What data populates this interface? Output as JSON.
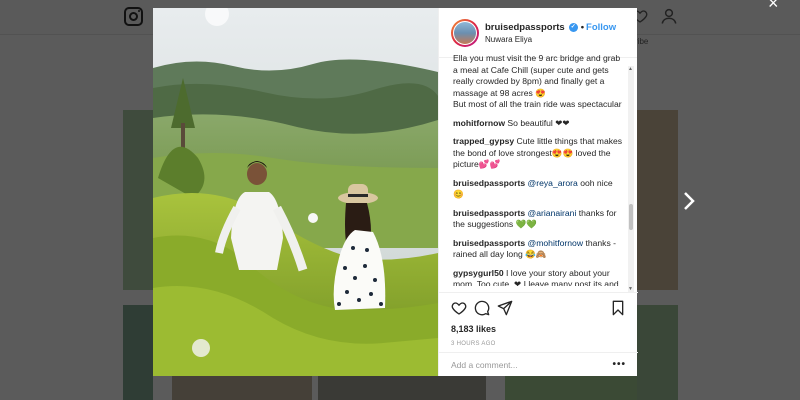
{
  "background": {
    "subscribe_fragment": "ribe"
  },
  "post": {
    "username": "bruisedpassports",
    "follow_label": "Follow",
    "location": "Nuwara Eliya",
    "likes": "8,183 likes",
    "time": "3 HOURS AGO",
    "comment_placeholder": "Add a comment...",
    "more_label": "•••"
  },
  "comments": [
    {
      "user": "",
      "text": "Ella you must visit the 9 arc bridge and grab a meal at Cafe Chill (super cute and gets really crowded by 8pm) and finally get a massage at 98 acres 😍\nBut most of all the train ride was spectacular"
    },
    {
      "user": "mohitfornow",
      "text": "So beautiful ❤❤"
    },
    {
      "user": "trapped_gypsy",
      "text": "Cute little things that makes the bond of love strongest😍😍 loved the picture💕💕"
    },
    {
      "user": "bruisedpassports",
      "mention": "@reya_arora",
      "text": "ooh nice 😊"
    },
    {
      "user": "bruisedpassports",
      "mention": "@arianairani",
      "text": "thanks for the suggestions 💚💚"
    },
    {
      "user": "bruisedpassports",
      "mention": "@mohitfornow",
      "text": "thanks - rained all day long 😂🙈"
    },
    {
      "user": "gypsygurl50",
      "text": "I love your story about your mom. Too cute. ❤ I leave many post its and to do lists but thnx to this post I realize I need to leave 'notes' too. 🙏"
    }
  ],
  "icons": {
    "instagram": "instagram-logo-icon",
    "heart": "heart-icon",
    "comment": "comment-icon",
    "share": "share-icon",
    "bookmark": "bookmark-icon",
    "close": "close-icon",
    "next": "chevron-right-icon",
    "verified": "verified-badge-icon"
  },
  "colors": {
    "accent": "#3897f0",
    "overlay": "#5b5b5b"
  }
}
